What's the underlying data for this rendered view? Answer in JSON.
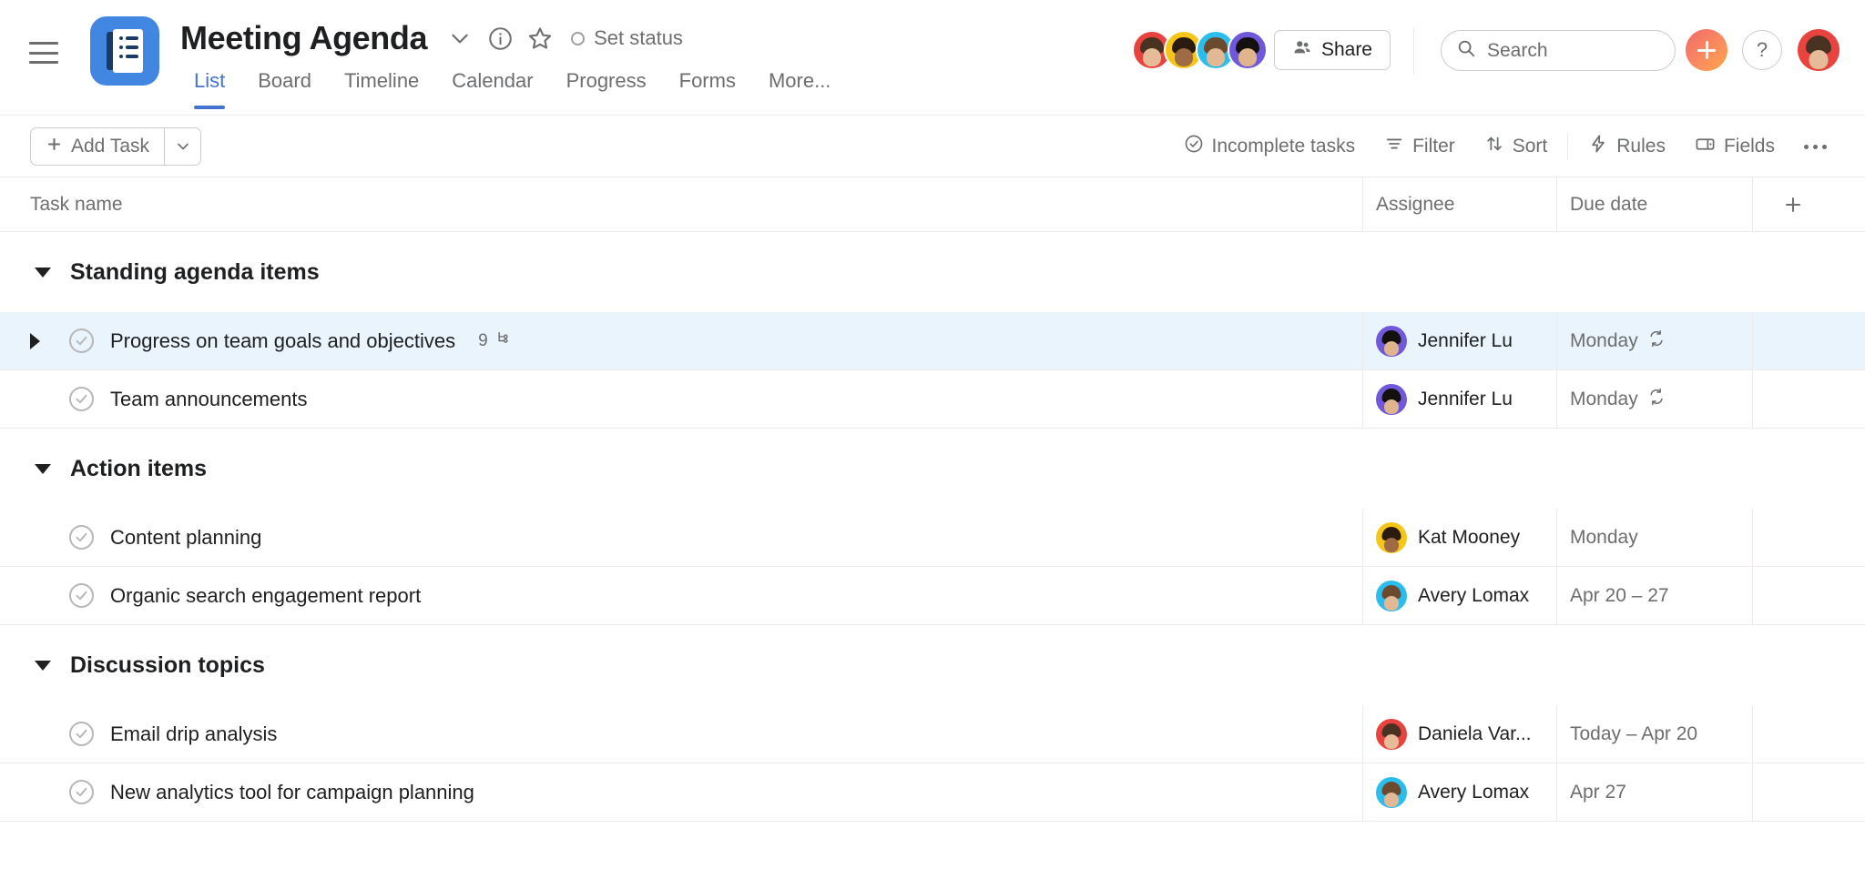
{
  "topbar": {
    "menu_icon": "hamburger-icon",
    "project_icon": "project-list-icon",
    "project_title": "Meeting Agenda",
    "dropdown_icon": "chevron-down-icon",
    "info_icon": "info-circle-icon",
    "star_icon": "star-outline-icon",
    "set_status_label": "Set status",
    "tabs": [
      {
        "label": "List",
        "active": true
      },
      {
        "label": "Board",
        "active": false
      },
      {
        "label": "Timeline",
        "active": false
      },
      {
        "label": "Calendar",
        "active": false
      },
      {
        "label": "Progress",
        "active": false
      },
      {
        "label": "Forms",
        "active": false
      },
      {
        "label": "More...",
        "active": false
      }
    ],
    "members": [
      {
        "ring": "#e8433f",
        "hair": "#4a3222",
        "skin": "#e6bb9a"
      },
      {
        "ring": "#f5c518",
        "hair": "#2b1a10",
        "skin": "#9e6b45"
      },
      {
        "ring": "#2bbdee",
        "hair": "#6b4a2e",
        "skin": "#e3b894"
      },
      {
        "ring": "#6f58d9",
        "hair": "#14100e",
        "skin": "#e0b48c"
      }
    ],
    "share_label": "Share",
    "share_icon": "people-icon",
    "search_icon": "search-icon",
    "search_placeholder": "Search",
    "search_value": "",
    "plus_icon": "plus-icon",
    "help_label": "?",
    "me_avatar": "user-avatar"
  },
  "toolbar": {
    "add_task_label": "Add Task",
    "add_task_plus_icon": "plus-icon",
    "add_task_caret_icon": "chevron-down-icon",
    "items": [
      {
        "label": "Incomplete tasks",
        "icon": "check-circle-icon"
      },
      {
        "label": "Filter",
        "icon": "filter-icon"
      },
      {
        "label": "Sort",
        "icon": "sort-arrows-icon"
      },
      {
        "label": "Rules",
        "icon": "lightning-icon"
      },
      {
        "label": "Fields",
        "icon": "fields-icon"
      }
    ],
    "more_icon": "ellipsis-icon"
  },
  "table": {
    "columns": {
      "name": "Task name",
      "assignee": "Assignee",
      "due": "Due date",
      "add": "+"
    },
    "sections": [
      {
        "title": "Standing agenda items",
        "rows": [
          {
            "name": "Progress on team goals and objectives",
            "subtask_count": "9",
            "subtask_icon": "subtask-icon",
            "expandable": true,
            "highlighted": true,
            "assignee": "Jennifer Lu",
            "avatar_ring": "#6f58d9",
            "avatar_hair": "#14100e",
            "avatar_skin": "#e0b48c",
            "due": "Monday",
            "recurring": true,
            "recurring_icon": "repeat-icon"
          },
          {
            "name": "Team announcements",
            "subtask_count": "",
            "expandable": false,
            "highlighted": false,
            "assignee": "Jennifer Lu",
            "avatar_ring": "#6f58d9",
            "avatar_hair": "#14100e",
            "avatar_skin": "#e0b48c",
            "due": "Monday",
            "recurring": true,
            "recurring_icon": "repeat-icon"
          }
        ]
      },
      {
        "title": "Action items",
        "rows": [
          {
            "name": "Content planning",
            "subtask_count": "",
            "expandable": false,
            "highlighted": false,
            "assignee": "Kat Mooney",
            "avatar_ring": "#f5c518",
            "avatar_hair": "#2b1a10",
            "avatar_skin": "#9e6b45",
            "due": "Monday",
            "recurring": false
          },
          {
            "name": "Organic search engagement report",
            "subtask_count": "",
            "expandable": false,
            "highlighted": false,
            "assignee": "Avery Lomax",
            "avatar_ring": "#2bbdee",
            "avatar_hair": "#6b4a2e",
            "avatar_skin": "#e3b894",
            "due": "Apr 20 – 27",
            "recurring": false
          }
        ]
      },
      {
        "title": "Discussion topics",
        "rows": [
          {
            "name": "Email drip analysis",
            "subtask_count": "",
            "expandable": false,
            "highlighted": false,
            "assignee": "Daniela Var...",
            "avatar_ring": "#e8433f",
            "avatar_hair": "#4a3222",
            "avatar_skin": "#e6bb9a",
            "due": "Today – Apr 20",
            "recurring": false
          },
          {
            "name": "New analytics tool for campaign planning",
            "subtask_count": "",
            "expandable": false,
            "highlighted": false,
            "assignee": "Avery Lomax",
            "avatar_ring": "#2bbdee",
            "avatar_hair": "#6b4a2e",
            "avatar_skin": "#e3b894",
            "due": "Apr 27",
            "recurring": false
          }
        ]
      }
    ]
  },
  "colors": {
    "accent": "#4573d2",
    "project_icon_bg": "#4186e0",
    "row_highlight": "#e9f4fd",
    "border": "#edeae9",
    "muted_text": "#6d6e6f"
  }
}
